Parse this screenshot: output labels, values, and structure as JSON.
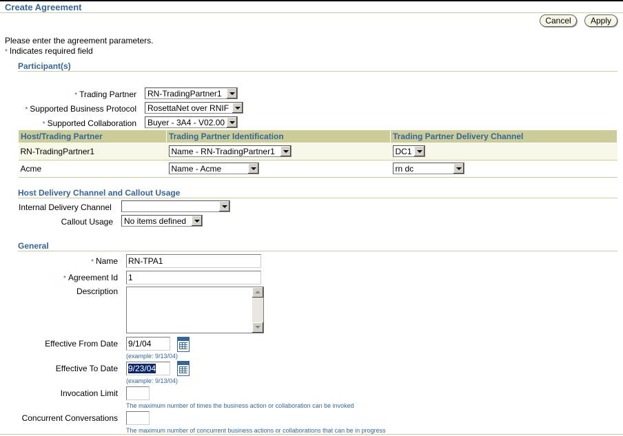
{
  "page": {
    "title": "Create Agreement",
    "cancel_label": "Cancel",
    "apply_label": "Apply",
    "intro": "Please enter the agreement parameters.",
    "required_marker": "*",
    "required_note": "Indicates required field"
  },
  "participants": {
    "heading": "Participant(s)",
    "trading_partner_label": "Trading Partner",
    "trading_partner_value": "RN-TradingPartner1",
    "protocol_label": "Supported Business Protocol",
    "protocol_value": "RosettaNet over RNIF",
    "collaboration_label": "Supported Collaboration",
    "collaboration_value": "Buyer - 3A4 - V02.00",
    "table": {
      "headers": [
        "Host/Trading Partner",
        "Trading Partner Identification",
        "Trading Partner Delivery Channel"
      ],
      "rows": [
        {
          "partner": "RN-TradingPartner1",
          "identification": "Name - RN-TradingPartner1",
          "channel": "DC1"
        },
        {
          "partner": "Acme",
          "identification": "Name - Acme",
          "channel": "rn dc"
        }
      ]
    }
  },
  "host_delivery": {
    "heading": "Host Delivery Channel and Callout Usage",
    "internal_channel_label": "Internal Delivery Channel",
    "internal_channel_value": "",
    "callout_label": "Callout Usage",
    "callout_value": "No items defined"
  },
  "general": {
    "heading": "General",
    "name_label": "Name",
    "name_value": "RN-TPA1",
    "agreement_id_label": "Agreement Id",
    "agreement_id_value": "1",
    "description_label": "Description",
    "description_value": "",
    "from_date_label": "Effective From Date",
    "from_date_value": "9/1/04",
    "from_date_hint": "(example: 9/13/04)",
    "to_date_label": "Effective To Date",
    "to_date_value": "9/23/04",
    "to_date_hint": "(example: 9/13/04)",
    "invocation_label": "Invocation Limit",
    "invocation_value": "",
    "invocation_hint": "The maximum number of times the business action or collaboration can be invoked",
    "concurrent_label": "Concurrent Conversations",
    "concurrent_value": "",
    "concurrent_hint": "The maximum number of concurrent business actions or collaborations that can be in progress"
  },
  "icons": {
    "calendar": "calendar-icon",
    "dropdown": "chevron-down-icon"
  },
  "colors": {
    "accent": "#336699",
    "rule": "#cccc99",
    "row_highlight": "#f7f7e7"
  }
}
